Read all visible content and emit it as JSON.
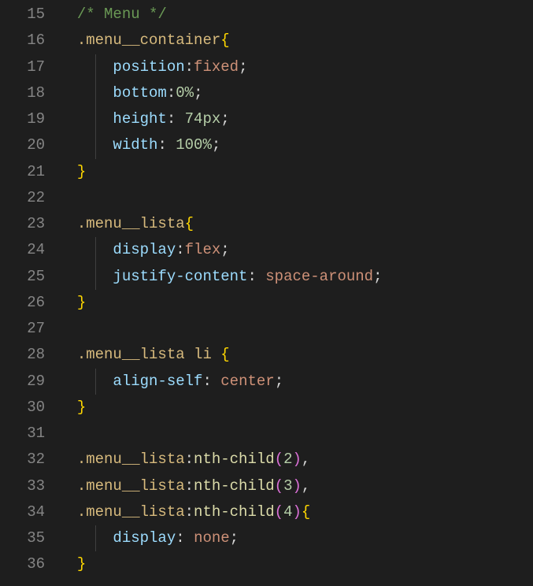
{
  "editor": {
    "gutter": [
      "15",
      "16",
      "17",
      "18",
      "19",
      "20",
      "21",
      "22",
      "23",
      "24",
      "25",
      "26",
      "27",
      "28",
      "29",
      "30",
      "31",
      "32",
      "33",
      "34",
      "35",
      "36"
    ],
    "lines": [
      [
        {
          "t": "/* Menu */",
          "c": "comment"
        }
      ],
      [
        {
          "t": ".menu__container",
          "c": "selector"
        },
        {
          "t": "{",
          "c": "brace"
        }
      ],
      [
        {
          "t": "position",
          "c": "property",
          "indent": true
        },
        {
          "t": ":",
          "c": "colon"
        },
        {
          "t": "fixed",
          "c": "value-keyword"
        },
        {
          "t": ";",
          "c": "punct"
        }
      ],
      [
        {
          "t": "bottom",
          "c": "property",
          "indent": true
        },
        {
          "t": ":",
          "c": "colon"
        },
        {
          "t": "0%",
          "c": "value-number"
        },
        {
          "t": ";",
          "c": "punct"
        }
      ],
      [
        {
          "t": "height",
          "c": "property",
          "indent": true
        },
        {
          "t": ":",
          "c": "colon"
        },
        {
          "t": " ",
          "c": "punct"
        },
        {
          "t": "74px",
          "c": "value-number"
        },
        {
          "t": ";",
          "c": "punct"
        }
      ],
      [
        {
          "t": "width",
          "c": "property",
          "indent": true
        },
        {
          "t": ":",
          "c": "colon"
        },
        {
          "t": " ",
          "c": "punct"
        },
        {
          "t": "100%",
          "c": "value-number"
        },
        {
          "t": ";",
          "c": "punct"
        }
      ],
      [
        {
          "t": "}",
          "c": "brace"
        }
      ],
      [],
      [
        {
          "t": ".menu__lista",
          "c": "selector"
        },
        {
          "t": "{",
          "c": "brace"
        }
      ],
      [
        {
          "t": "display",
          "c": "property",
          "indent": true
        },
        {
          "t": ":",
          "c": "colon"
        },
        {
          "t": "flex",
          "c": "value-keyword"
        },
        {
          "t": ";",
          "c": "punct"
        }
      ],
      [
        {
          "t": "justify-content",
          "c": "property",
          "indent": true
        },
        {
          "t": ":",
          "c": "colon"
        },
        {
          "t": " ",
          "c": "punct"
        },
        {
          "t": "space-around",
          "c": "value-keyword"
        },
        {
          "t": ";",
          "c": "punct"
        }
      ],
      [
        {
          "t": "}",
          "c": "brace"
        }
      ],
      [],
      [
        {
          "t": ".menu__lista",
          "c": "selector"
        },
        {
          "t": " ",
          "c": "punct"
        },
        {
          "t": "li",
          "c": "selector"
        },
        {
          "t": " ",
          "c": "punct"
        },
        {
          "t": "{",
          "c": "brace"
        }
      ],
      [
        {
          "t": "align-self",
          "c": "property",
          "indent": true
        },
        {
          "t": ":",
          "c": "colon"
        },
        {
          "t": " ",
          "c": "punct"
        },
        {
          "t": "center",
          "c": "value-keyword"
        },
        {
          "t": ";",
          "c": "punct"
        }
      ],
      [
        {
          "t": "}",
          "c": "brace"
        }
      ],
      [],
      [
        {
          "t": ".menu__lista",
          "c": "selector"
        },
        {
          "t": ":",
          "c": "punct"
        },
        {
          "t": "nth-child",
          "c": "func"
        },
        {
          "t": "(",
          "c": "paren"
        },
        {
          "t": "2",
          "c": "value-number"
        },
        {
          "t": ")",
          "c": "paren"
        },
        {
          "t": ",",
          "c": "punct"
        }
      ],
      [
        {
          "t": ".menu__lista",
          "c": "selector"
        },
        {
          "t": ":",
          "c": "punct"
        },
        {
          "t": "nth-child",
          "c": "func"
        },
        {
          "t": "(",
          "c": "paren"
        },
        {
          "t": "3",
          "c": "value-number"
        },
        {
          "t": ")",
          "c": "paren"
        },
        {
          "t": ",",
          "c": "punct"
        }
      ],
      [
        {
          "t": ".menu__lista",
          "c": "selector"
        },
        {
          "t": ":",
          "c": "punct"
        },
        {
          "t": "nth-child",
          "c": "func"
        },
        {
          "t": "(",
          "c": "paren"
        },
        {
          "t": "4",
          "c": "value-number"
        },
        {
          "t": ")",
          "c": "paren"
        },
        {
          "t": "{",
          "c": "brace"
        }
      ],
      [
        {
          "t": "display",
          "c": "property",
          "indent": true
        },
        {
          "t": ":",
          "c": "colon"
        },
        {
          "t": " ",
          "c": "punct"
        },
        {
          "t": "none",
          "c": "value-keyword"
        },
        {
          "t": ";",
          "c": "punct"
        }
      ],
      [
        {
          "t": "}",
          "c": "brace"
        }
      ]
    ]
  }
}
